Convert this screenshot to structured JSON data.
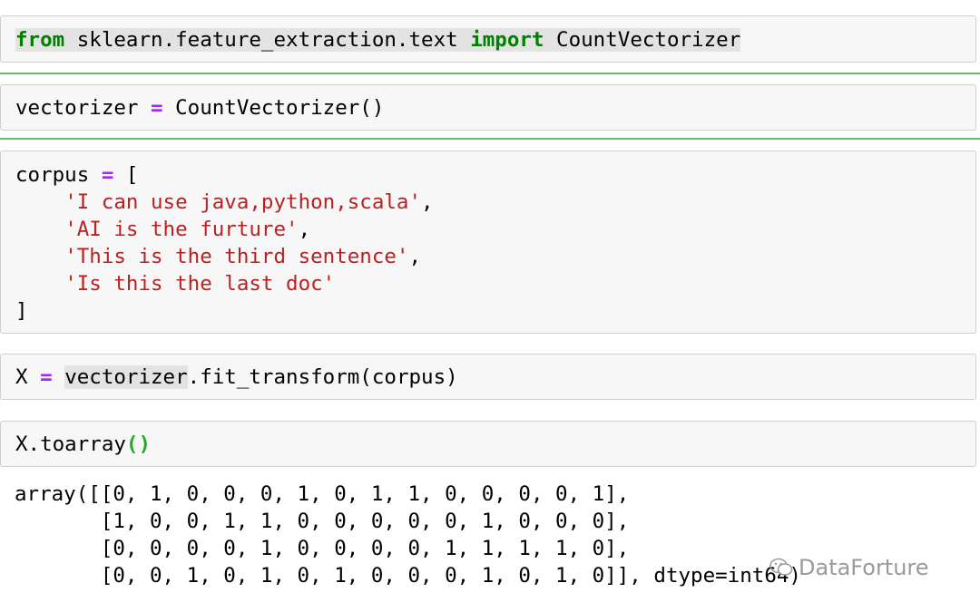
{
  "colors": {
    "keyword": "#008000",
    "operator": "#aa22ff",
    "string": "#ba2121",
    "selection_line": "#66bb6a",
    "cell_bg": "#f7f7f7"
  },
  "cells": {
    "c1": {
      "kw_from": "from",
      "module": " sklearn.feature_extraction.text ",
      "kw_import": "import",
      "name": " CountVectorizer"
    },
    "c2": {
      "lhs": "vectorizer ",
      "op": "=",
      "rhs": " CountVectorizer()"
    },
    "c3": {
      "head_lhs": "corpus ",
      "op": "=",
      "head_rhs": " [",
      "indent": "    ",
      "strings": [
        "'I can use java,python,scala'",
        "'AI is the furture'",
        "'This is the third sentence'",
        "'Is this the last doc'"
      ],
      "sep": [
        ",",
        ",",
        ",",
        ""
      ],
      "close": "]"
    },
    "c4": {
      "lhs": "X ",
      "op": "=",
      "sp": " ",
      "obj": "vectorizer",
      "rest": ".fit_transform(corpus)"
    },
    "c5": {
      "call": "X.toarray",
      "parens": "()"
    }
  },
  "output": {
    "lines": [
      "array([[0, 1, 0, 0, 0, 1, 0, 1, 1, 0, 0, 0, 0, 1],",
      "       [1, 0, 0, 1, 1, 0, 0, 0, 0, 0, 1, 0, 0, 0],",
      "       [0, 0, 0, 0, 1, 0, 0, 0, 0, 1, 1, 1, 1, 0],",
      "       [0, 0, 1, 0, 1, 0, 1, 0, 0, 0, 1, 0, 1, 0]], dtype=int64)"
    ]
  },
  "watermark": {
    "text": "DataForture",
    "icon": "wechat-icon"
  }
}
